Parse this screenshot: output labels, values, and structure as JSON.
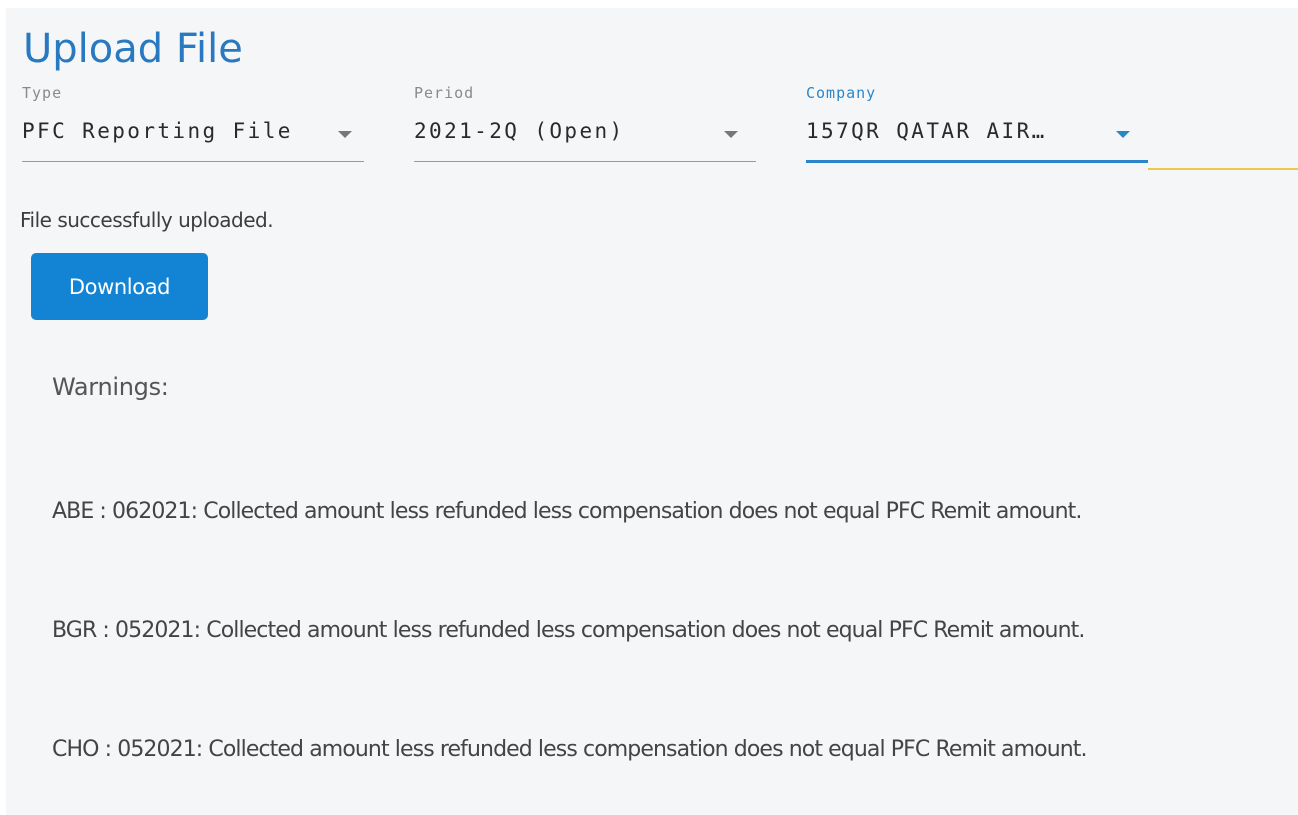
{
  "page": {
    "title": "Upload File"
  },
  "filters": {
    "type": {
      "label": "Type",
      "value": "PFC Reporting File"
    },
    "period": {
      "label": "Period",
      "value": "2021-2Q (Open)"
    },
    "company": {
      "label": "Company",
      "value": "157QR QATAR AIR…"
    }
  },
  "colors": {
    "title": "#2879c0",
    "accent": "#2a86c8",
    "button": "#1384d4",
    "divider": "#f0c64e"
  },
  "status": {
    "message": "File successfully uploaded."
  },
  "actions": {
    "download_label": "Download"
  },
  "warnings": {
    "heading": "Warnings:",
    "items": [
      "ABE : 062021: Collected amount less refunded less compensation does not equal PFC Remit amount.",
      "BGR : 052021: Collected amount less refunded less compensation does not equal PFC Remit amount.",
      "CHO : 052021: Collected amount less refunded less compensation does not equal PFC Remit amount."
    ]
  }
}
